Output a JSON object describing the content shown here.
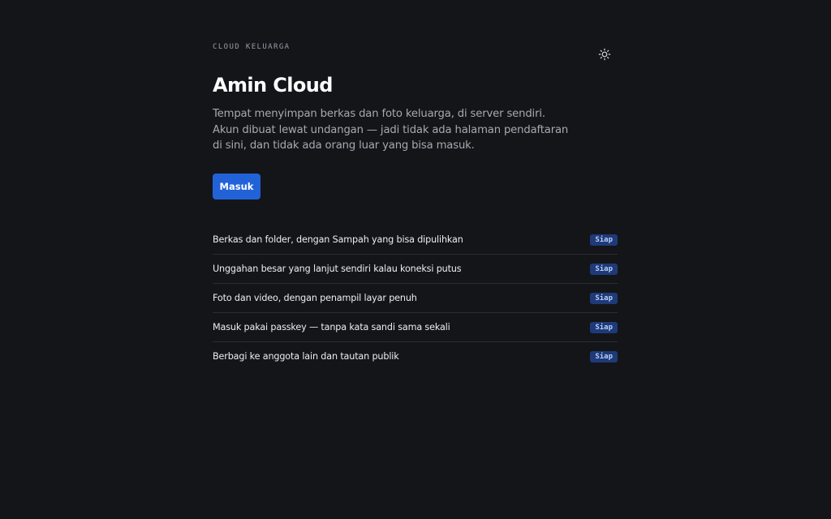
{
  "header": {
    "eyebrow": "CLOUD KELUARGA",
    "theme_toggle_icon": "sun-icon"
  },
  "hero": {
    "title": "Amin Cloud",
    "description": "Tempat menyimpan berkas dan foto keluarga, di server sendiri. Akun dibuat lewat undangan — jadi tidak ada halaman pendaftaran di sini, dan tidak ada orang luar yang bisa masuk.",
    "login_label": "Masuk"
  },
  "features": [
    {
      "text": "Berkas dan folder, dengan Sampah yang bisa dipulihkan",
      "status": "Siap"
    },
    {
      "text": "Unggahan besar yang lanjut sendiri kalau koneksi putus",
      "status": "Siap"
    },
    {
      "text": "Foto dan video, dengan penampil layar penuh",
      "status": "Siap"
    },
    {
      "text": "Masuk pakai passkey — tanpa kata sandi sama sekali",
      "status": "Siap"
    },
    {
      "text": "Berbagi ke anggota lain dan tautan publik",
      "status": "Siap"
    }
  ],
  "colors": {
    "background": "#141519",
    "accent": "#2262d8",
    "badge_bg": "#1e3a78",
    "badge_text": "#b9cdf7"
  }
}
